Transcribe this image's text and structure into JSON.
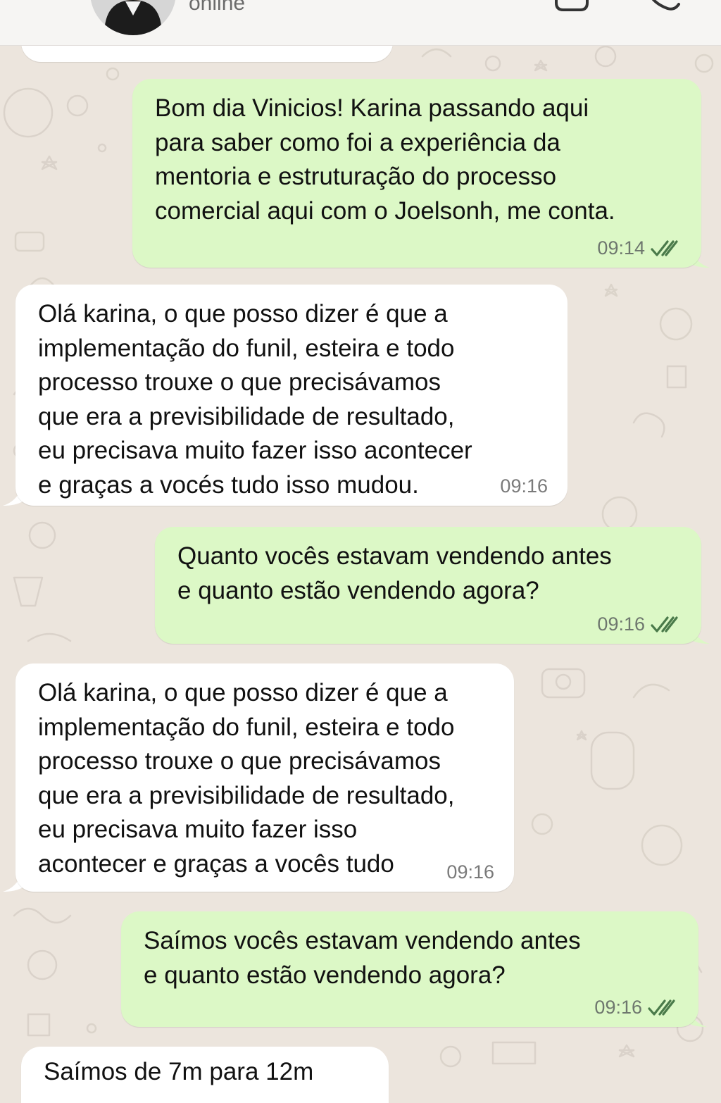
{
  "header": {
    "status": "online"
  },
  "messages": [
    {
      "direction": "outgoing",
      "text": "Bom dia Vinicios! Karina passando aqui\npara saber como foi a experiência da\nmentoria e estruturação do processo\ncomercial aqui com o Joelsonh, me conta.",
      "time": "09:14",
      "read": true
    },
    {
      "direction": "incoming",
      "text": "Olá karina, o que posso dizer é que a\nimplementação do funil, esteira e todo\nprocesso trouxe o que precisávamos\nque era a previsibilidade de resultado,\neu precisava muito fazer isso acontecer\ne graças a vocés tudo isso mudou.",
      "time": "09:16"
    },
    {
      "direction": "outgoing",
      "text": "Quanto vocês estavam vendendo antes\ne quanto estão vendendo agora?",
      "time": "09:16",
      "read": true
    },
    {
      "direction": "incoming",
      "text": "Olá karina, o que posso dizer é que a\nimplementação do funil, esteira e todo\nprocesso trouxe o que precisávamos\nque era a previsibilidade de resultado,\neu precisava muito fazer isso\nacontecer e graças a vocês tudo",
      "time": "09:16"
    },
    {
      "direction": "outgoing",
      "text": "Saímos vocês estavam vendendo antes\ne quanto estão vendendo agora?",
      "time": "09:16",
      "read": true
    },
    {
      "direction": "incoming",
      "text": "Saímos de 7m para 12m",
      "time": ""
    }
  ],
  "colors": {
    "wallpaper": "#ece5dd",
    "outgoing_bubble": "#dcf8c6",
    "incoming_bubble": "#ffffff",
    "read_ticks": "#4a7a4a"
  }
}
